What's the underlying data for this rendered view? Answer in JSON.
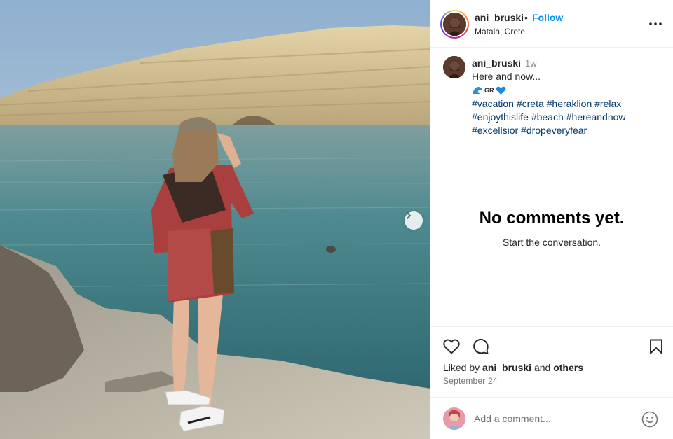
{
  "post": {
    "author": "ani_bruski",
    "separator": "•",
    "follow_label": "Follow",
    "location": "Matala, Crete",
    "more_icon": "more-horizontal-icon"
  },
  "caption": {
    "username": "ani_bruski",
    "time": "1w",
    "text": "Here and now...",
    "flag_text": "GR",
    "hashtags": [
      "#vacation",
      "#creta",
      "#heraklion",
      "#relax",
      "#enjoythislife",
      "#beach",
      "#hereandnow",
      "#excellsior",
      "#dropeveryfear"
    ]
  },
  "comments": {
    "empty_title": "No comments yet.",
    "empty_subtitle": "Start the conversation."
  },
  "actions": {
    "like_icon": "heart-icon",
    "comment_icon": "comment-icon",
    "save_icon": "bookmark-icon",
    "liked_prefix": "Liked by",
    "liked_user": "ani_bruski",
    "liked_and": "and",
    "liked_others": "others",
    "date": "September 24"
  },
  "comment_box": {
    "placeholder": "Add a comment...",
    "emoji_icon": "emoji-icon"
  },
  "media": {
    "next_icon": "chevron-right-icon"
  },
  "colors": {
    "link": "#0095f6",
    "hashtag": "#00376b",
    "muted": "#737373"
  }
}
